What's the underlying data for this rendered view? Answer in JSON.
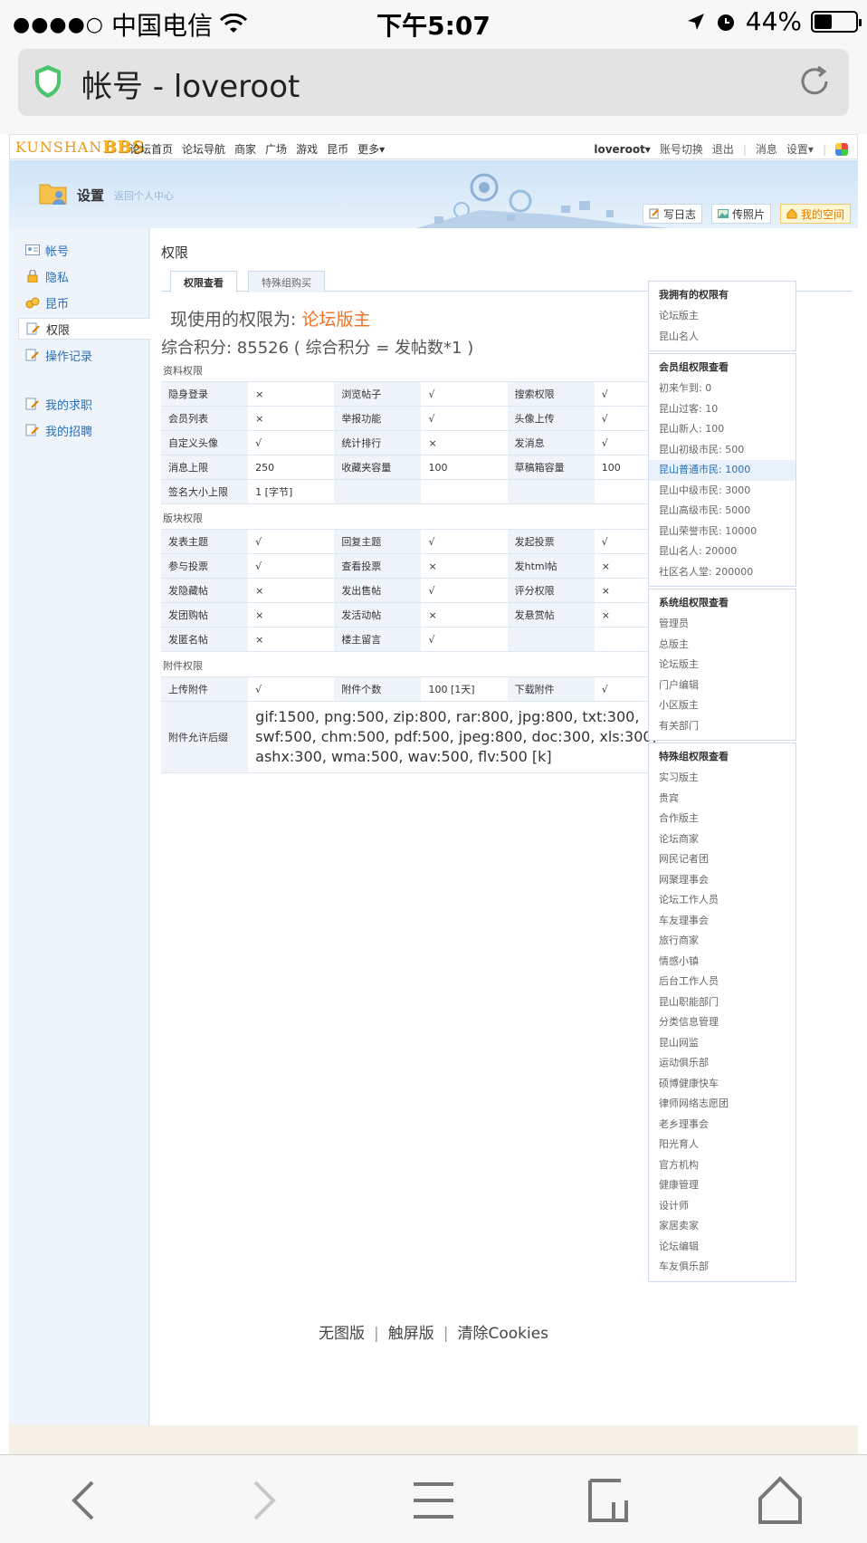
{
  "statusbar": {
    "signal": "●●●●○",
    "carrier": "中国电信",
    "time": "下午5:07",
    "battery_text": "44%",
    "battery_level": 0.44
  },
  "browser": {
    "title": "帐号 - loveroot"
  },
  "site": {
    "logo_text": "KUNSHAN",
    "logo_bbs": "BBS",
    "nav": [
      "论坛首页",
      "论坛导航",
      "商家",
      "广场",
      "游戏",
      "昆币",
      "更多▾"
    ],
    "user": "loveroot▾",
    "right_links": [
      "账号切换",
      "退出",
      "消息",
      "设置▾"
    ]
  },
  "banner": {
    "title": "设置",
    "back": "返回个人中心",
    "buttons": [
      "写日志",
      "传照片",
      "我的空间"
    ]
  },
  "sidebar": {
    "items": [
      "帐号",
      "隐私",
      "昆币",
      "权限",
      "操作记录"
    ],
    "items2": [
      "我的求职",
      "我的招聘"
    ]
  },
  "main": {
    "heading": "权限",
    "tabs": [
      "权限查看",
      "特殊组购买"
    ],
    "current_prefix": "现使用的权限为:",
    "current_level": "论坛版主",
    "score_line": "综合积分:  85526   ( 综合积分 = 发帖数*1 )",
    "sections": [
      "资料权限",
      "版块权限",
      "附件权限"
    ],
    "profile_rows": [
      [
        "隐身登录",
        "×",
        "浏览帖子",
        "√",
        "搜索权限",
        "√"
      ],
      [
        "会员列表",
        "×",
        "举报功能",
        "√",
        "头像上传",
        "√"
      ],
      [
        "自定义头像",
        "√",
        "统计排行",
        "×",
        "发消息",
        "√"
      ],
      [
        "消息上限",
        "250",
        "收藏夹容量",
        "100",
        "草稿箱容量",
        "100"
      ],
      [
        "签名大小上限",
        "1 [字节]",
        "",
        "",
        "",
        ""
      ]
    ],
    "forum_rows": [
      [
        "发表主题",
        "√",
        "回复主题",
        "√",
        "发起投票",
        "√"
      ],
      [
        "参与投票",
        "√",
        "查看投票",
        "×",
        "发html帖",
        "×"
      ],
      [
        "发隐藏帖",
        "×",
        "发出售帖",
        "√",
        "评分权限",
        "×"
      ],
      [
        "发团购帖",
        "×",
        "发活动帖",
        "×",
        "发悬赏帖",
        "×"
      ],
      [
        "发匿名帖",
        "×",
        "楼主留言",
        "√",
        "",
        ""
      ]
    ],
    "attach_row": [
      "上传附件",
      "√",
      "附件个数",
      "100 [1天]",
      "下载附件",
      "√"
    ],
    "attach_ext_label": "附件允许后缀",
    "attach_ext_value": "gif:1500, png:500, zip:800, rar:800, jpg:800, txt:300, swf:500, chm:500, pdf:500, jpeg:800, doc:300, xls:300, ashx:300, wma:500, wav:500, flv:500 [k]"
  },
  "right": {
    "own_title": "我拥有的权限有",
    "own_items": [
      "论坛版主",
      "昆山名人"
    ],
    "member_title": "会员组权限查看",
    "member_items": [
      "初来乍到: 0",
      "昆山过客: 10",
      "昆山新人: 100",
      "昆山初级市民: 500",
      "昆山普通市民: 1000",
      "昆山中级市民: 3000",
      "昆山高级市民: 5000",
      "昆山荣誉市民: 10000",
      "昆山名人: 20000",
      "社区名人堂: 200000"
    ],
    "system_title": "系统组权限查看",
    "system_items": [
      "管理员",
      "总版主",
      "论坛版主",
      "门户编辑",
      "小区版主",
      "有关部门"
    ],
    "special_title": "特殊组权限查看",
    "special_items": [
      "实习版主",
      "贵宾",
      "合作版主",
      "论坛商家",
      "网民记者团",
      "网聚理事会",
      "论坛工作人员",
      "车友理事会",
      "旅行商家",
      "情感小镇",
      "后台工作人员",
      "昆山职能部门",
      "分类信息管理",
      "昆山网监",
      "运动俱乐部",
      "硕博健康快车",
      "律师网络志愿团",
      "老乡理事会",
      "阳光育人",
      "官方机构",
      "健康管理",
      "设计师",
      "家居卖家",
      "论坛编辑",
      "车友俱乐部"
    ]
  },
  "footer": {
    "links": [
      "无图版",
      "触屏版",
      "清除Cookies"
    ]
  }
}
